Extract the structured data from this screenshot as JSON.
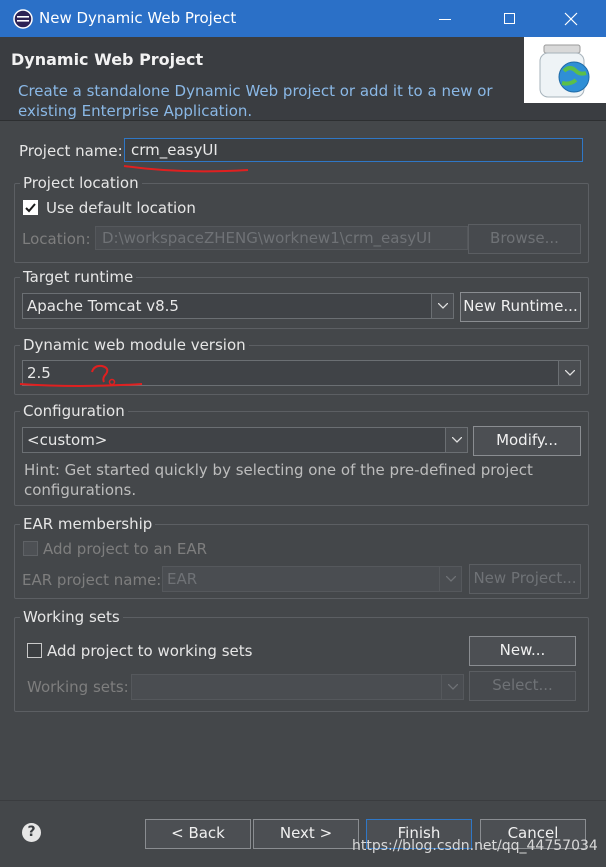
{
  "window": {
    "title": "New Dynamic Web Project"
  },
  "header": {
    "title": "Dynamic Web Project",
    "description": "Create a standalone Dynamic Web project or add it to a new or existing Enterprise Application."
  },
  "project_name": {
    "label": "Project name:",
    "value": "crm_easyUI"
  },
  "project_location": {
    "title": "Project location",
    "use_default_label": "Use default location",
    "location_label": "Location:",
    "location_value": "D:\\workspaceZHENG\\worknew1\\crm_easyUI",
    "browse_label": "Browse..."
  },
  "target_runtime": {
    "title": "Target runtime",
    "value": "Apache Tomcat v8.5",
    "new_runtime_label": "New Runtime..."
  },
  "module_version": {
    "title": "Dynamic web module version",
    "value": "2.5"
  },
  "configuration": {
    "title": "Configuration",
    "value": "<custom>",
    "modify_label": "Modify...",
    "hint": "Hint: Get started quickly by selecting one of the pre-defined project configurations."
  },
  "ear": {
    "title": "EAR membership",
    "add_label": "Add project to an EAR",
    "name_label": "EAR project name:",
    "name_value": "EAR",
    "new_project_label": "New Project..."
  },
  "working_sets": {
    "title": "Working sets",
    "add_label": "Add project to working sets",
    "new_label": "New...",
    "sets_label": "Working sets:",
    "select_label": "Select..."
  },
  "footer": {
    "help_label": "?",
    "back_label": "< Back",
    "next_label": "Next >",
    "finish_label": "Finish",
    "cancel_label": "Cancel",
    "watermark": "https://blog.csdn.net/qq_44757034"
  },
  "colors": {
    "titlebar": "#2b70c7",
    "background": "#44474a",
    "accent": "#2f77c6",
    "annotation": "#e02020"
  }
}
